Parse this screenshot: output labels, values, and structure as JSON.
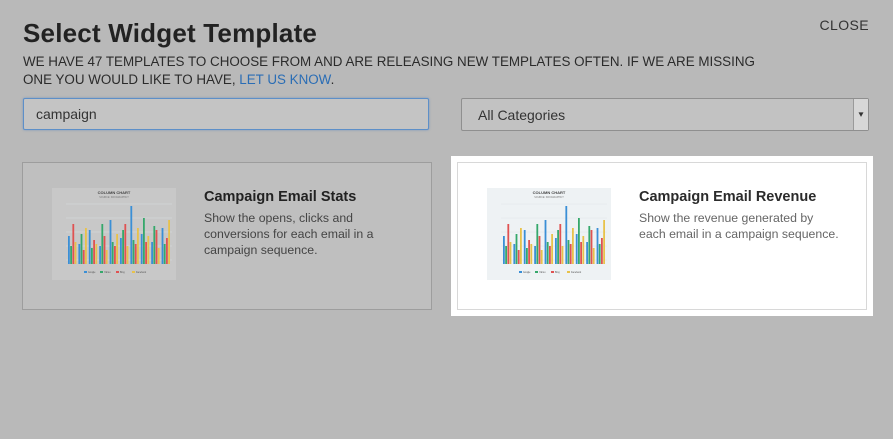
{
  "dialog": {
    "title": "Select Widget Template",
    "close_label": "CLOSE",
    "subtitle_text": "WE HAVE 47 TEMPLATES TO CHOOSE FROM AND ARE RELEASING NEW TEMPLATES OFTEN. IF WE ARE MISSING ONE YOU WOULD LIKE TO HAVE, ",
    "subtitle_link": "LET US KNOW",
    "subtitle_end": "."
  },
  "search": {
    "value": "campaign"
  },
  "category_select": {
    "selected": "All Categories"
  },
  "templates": [
    {
      "title": "Campaign Email Stats",
      "description": "Show the opens, clicks and conversions for each email in a campaign sequence."
    },
    {
      "title": "Campaign Email Revenue",
      "description": "Show the revenue generated by each email in a campaign sequence."
    }
  ],
  "thumbnail": {
    "title": "COLUMN CHART",
    "subtitle": "SOURCE: INFOGRAPHIC?",
    "series_colors": [
      "#3a8fd6",
      "#35a86b",
      "#e05252",
      "#e8c24a"
    ],
    "legend": [
      "Google",
      "Yahoo",
      "Bing",
      "Facebook"
    ]
  }
}
